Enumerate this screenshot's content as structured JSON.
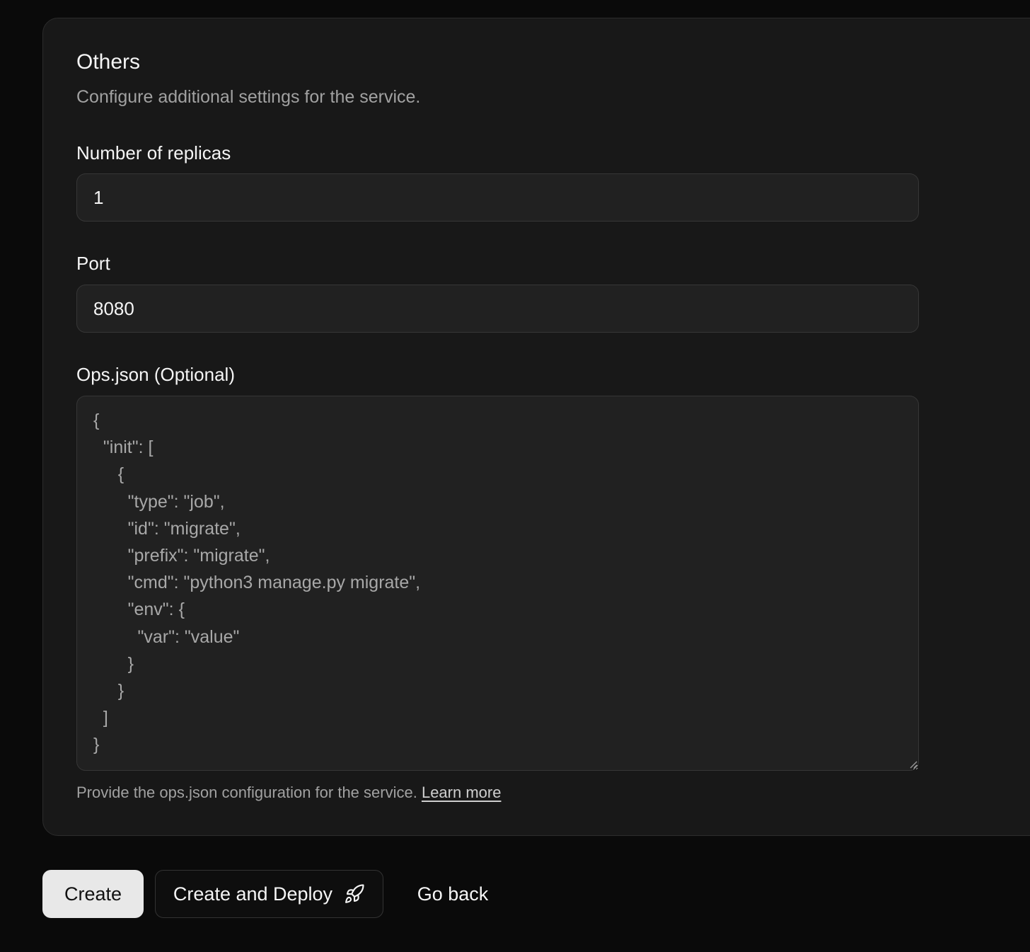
{
  "section": {
    "title": "Others",
    "description": "Configure additional settings for the service."
  },
  "replicas": {
    "label": "Number of replicas",
    "value": "1"
  },
  "port": {
    "label": "Port",
    "value": "8080"
  },
  "ops_json": {
    "label": "Ops.json (Optional)",
    "value": "{\n  \"init\": [\n     {\n       \"type\": \"job\",\n       \"id\": \"migrate\",\n       \"prefix\": \"migrate\",\n       \"cmd\": \"python3 manage.py migrate\",\n       \"env\": {\n         \"var\": \"value\"\n       }\n     }\n  ]\n}",
    "helper_text": "Provide the ops.json configuration for the service.",
    "learn_more": "Learn more"
  },
  "actions": {
    "create": "Create",
    "create_and_deploy": "Create and Deploy",
    "deploy_icon": "rocket-icon",
    "go_back": "Go back"
  },
  "colors": {
    "page_bg": "#0a0a0a",
    "card_bg": "#181818",
    "input_bg": "#212121",
    "primary_button": "#e8e8e8"
  }
}
